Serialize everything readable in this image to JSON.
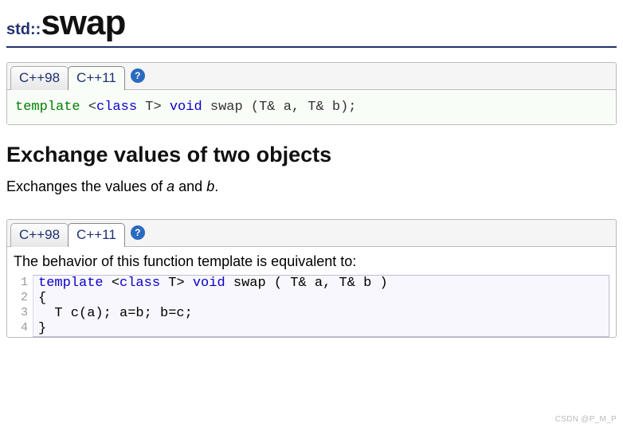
{
  "title": {
    "namespace": "std::",
    "name": "swap"
  },
  "declaration_block": {
    "tabs": [
      "C++98",
      "C++11"
    ],
    "active_tab": "C++11",
    "help": "?",
    "code_tokens": [
      {
        "t": "template",
        "c": "kw-green"
      },
      {
        "t": " <"
      },
      {
        "t": "class",
        "c": "kw-blue"
      },
      {
        "t": " T> "
      },
      {
        "t": "void",
        "c": "kw-blue"
      },
      {
        "t": " swap (T& a, T& b);"
      }
    ]
  },
  "section_heading": "Exchange values of two objects",
  "description_sentence": {
    "prefix": "Exchanges the values of ",
    "a": "a",
    "mid": " and ",
    "b": "b",
    "suffix": "."
  },
  "behavior_block": {
    "tabs": [
      "C++98",
      "C++11"
    ],
    "active_tab": "C++11",
    "help": "?",
    "intro": "The behavior of this function template is equivalent to:",
    "code_lines": [
      [
        {
          "t": "template",
          "c": "kw-blue"
        },
        {
          "t": " <"
        },
        {
          "t": "class",
          "c": "kw-blue"
        },
        {
          "t": " T> "
        },
        {
          "t": "void",
          "c": "kw-blue"
        },
        {
          "t": " swap ( T& a, T& b )"
        }
      ],
      [
        {
          "t": "{"
        }
      ],
      [
        {
          "t": "  T c(a); a=b; b=c;"
        }
      ],
      [
        {
          "t": "}"
        }
      ]
    ]
  },
  "watermark": "CSDN @P_M_P"
}
